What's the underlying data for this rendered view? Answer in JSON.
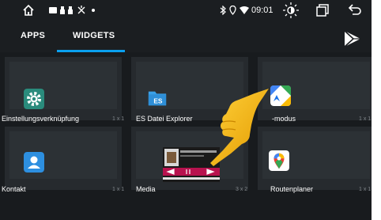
{
  "status": {
    "time": "09:01"
  },
  "tabs": [
    {
      "label": "APPS",
      "active": false
    },
    {
      "label": "WIDGETS",
      "active": true
    }
  ],
  "colors": {
    "accent": "#0aa0ef",
    "background": "#1f2326",
    "pointer": "#f6b60c"
  },
  "widgets": [
    {
      "label": "Einstellungsverknüpfung",
      "size": "1 x 1",
      "icon": "settings-gear-icon"
    },
    {
      "label": "ES Datei Explorer",
      "size": "",
      "icon": "es-file-explorer-icon"
    },
    {
      "label": "-modus",
      "size": "1 x 1",
      "icon": "google-maps-icon"
    },
    {
      "label": "Kontakt",
      "size": "1 x 1",
      "icon": "contact-person-icon"
    },
    {
      "label": "Media",
      "size": "3 x 2",
      "icon": "media-player-icon"
    },
    {
      "label": "Routenplaner",
      "size": "1 x 1",
      "icon": "maps-pin-icon"
    }
  ]
}
